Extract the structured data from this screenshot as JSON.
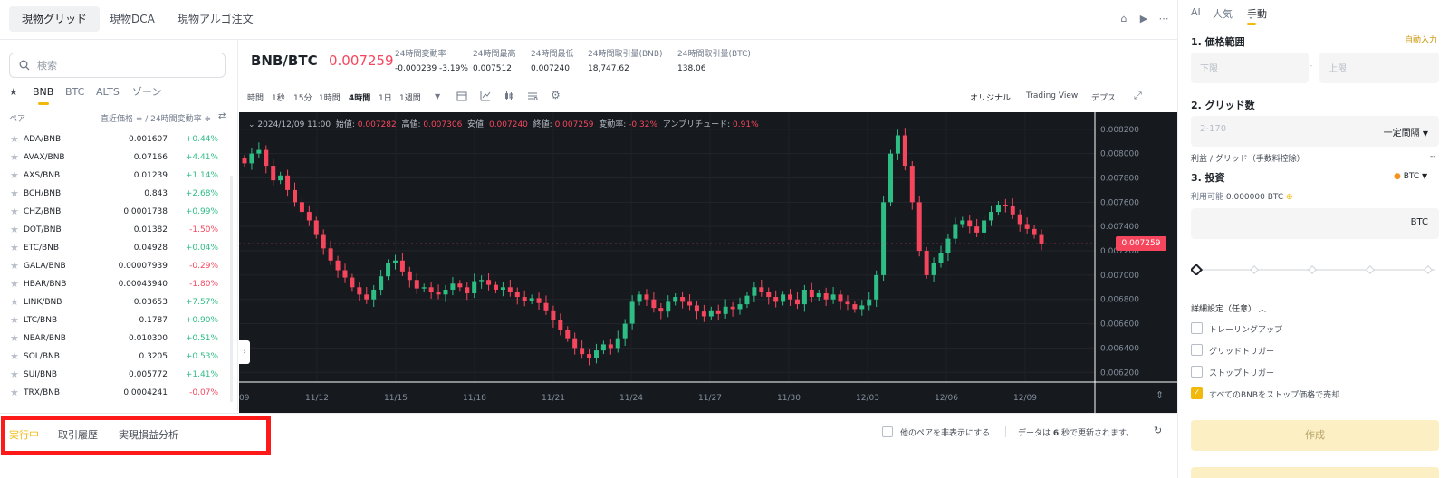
{
  "top_tabs": [
    "現物グリッド",
    "現物DCA",
    "現物アルゴ注文"
  ],
  "search": {
    "placeholder": "検索"
  },
  "quote_tabs": [
    "BNB",
    "BTC",
    "ALTS",
    "ゾーン"
  ],
  "list_header": {
    "pair": "ペア",
    "price_change": "直近価格 ≑ / 24時間変動率 ≑"
  },
  "markets": [
    {
      "pair": "ADA/BNB",
      "price": "0.001607",
      "change": "+0.44%",
      "dir": "up"
    },
    {
      "pair": "AVAX/BNB",
      "price": "0.07166",
      "change": "+4.41%",
      "dir": "up"
    },
    {
      "pair": "AXS/BNB",
      "price": "0.01239",
      "change": "+1.14%",
      "dir": "up"
    },
    {
      "pair": "BCH/BNB",
      "price": "0.843",
      "change": "+2.68%",
      "dir": "up"
    },
    {
      "pair": "CHZ/BNB",
      "price": "0.0001738",
      "change": "+0.99%",
      "dir": "up"
    },
    {
      "pair": "DOT/BNB",
      "price": "0.01382",
      "change": "-1.50%",
      "dir": "down"
    },
    {
      "pair": "ETC/BNB",
      "price": "0.04928",
      "change": "+0.04%",
      "dir": "up"
    },
    {
      "pair": "GALA/BNB",
      "price": "0.00007939",
      "change": "-0.29%",
      "dir": "down"
    },
    {
      "pair": "HBAR/BNB",
      "price": "0.00043940",
      "change": "-1.80%",
      "dir": "down"
    },
    {
      "pair": "LINK/BNB",
      "price": "0.03653",
      "change": "+7.57%",
      "dir": "up"
    },
    {
      "pair": "LTC/BNB",
      "price": "0.1787",
      "change": "+0.90%",
      "dir": "up"
    },
    {
      "pair": "NEAR/BNB",
      "price": "0.010300",
      "change": "+0.51%",
      "dir": "up"
    },
    {
      "pair": "SOL/BNB",
      "price": "0.3205",
      "change": "+0.53%",
      "dir": "up"
    },
    {
      "pair": "SUI/BNB",
      "price": "0.005772",
      "change": "+1.41%",
      "dir": "up"
    },
    {
      "pair": "TRX/BNB",
      "price": "0.0004241",
      "change": "-0.07%",
      "dir": "down"
    }
  ],
  "header": {
    "symbol": "BNB/BTC",
    "last_price": "0.007259",
    "stats": [
      {
        "label": "24時間変動率",
        "value": "-0.000239 -3.19%",
        "negative": true
      },
      {
        "label": "24時間最高",
        "value": "0.007512"
      },
      {
        "label": "24時間最低",
        "value": "0.007240"
      },
      {
        "label": "24時間取引量(BNB)",
        "value": "18,747.62"
      },
      {
        "label": "24時間取引量(BTC)",
        "value": "138.06"
      }
    ]
  },
  "timeframes": [
    "時間",
    "1秒",
    "15分",
    "1時間",
    "4時間",
    "1日",
    "1週間"
  ],
  "active_timeframe": "4時間",
  "chart_views": [
    "オリジナル",
    "Trading View",
    "デプス"
  ],
  "ohlc": {
    "date": "2024/12/09 11:00",
    "open_label": "始値:",
    "open": "0.007282",
    "high_label": "高値:",
    "high": "0.007306",
    "low_label": "安値:",
    "low": "0.007240",
    "close_label": "終値:",
    "close": "0.007259",
    "change_label": "変動率:",
    "change": "-0.32%",
    "amp_label": "アンプリチュード:",
    "amp": "0.91%"
  },
  "chart_data": {
    "type": "candlestick",
    "x_ticks": [
      "09",
      "11/12",
      "11/15",
      "11/18",
      "11/21",
      "11/24",
      "11/27",
      "11/30",
      "12/03",
      "12/06",
      "12/09"
    ],
    "y_ticks": [
      "0.008200",
      "0.008000",
      "0.007800",
      "0.007600",
      "0.007400",
      "0.007200",
      "0.007000",
      "0.006800",
      "0.006600",
      "0.006400",
      "0.006200"
    ],
    "ylim": [
      0.00612,
      0.00834
    ],
    "last_price": 0.007259,
    "close_path": [
      0.00792,
      0.008,
      0.00803,
      0.0079,
      0.00778,
      0.00782,
      0.0077,
      0.0076,
      0.00752,
      0.00745,
      0.00733,
      0.00722,
      0.00712,
      0.00704,
      0.00698,
      0.0069,
      0.00684,
      0.0068,
      0.00688,
      0.00699,
      0.0071,
      0.00712,
      0.00703,
      0.00696,
      0.00689,
      0.0069,
      0.00686,
      0.00684,
      0.00688,
      0.00693,
      0.0069,
      0.00685,
      0.00695,
      0.00696,
      0.00692,
      0.00688,
      0.0069,
      0.00686,
      0.00682,
      0.00679,
      0.00681,
      0.00677,
      0.00671,
      0.00663,
      0.00655,
      0.00648,
      0.0064,
      0.00635,
      0.00632,
      0.00638,
      0.00643,
      0.0064,
      0.00648,
      0.0066,
      0.00678,
      0.00684,
      0.0068,
      0.00673,
      0.0067,
      0.00678,
      0.00682,
      0.00678,
      0.00675,
      0.0067,
      0.00666,
      0.00671,
      0.00668,
      0.00674,
      0.00672,
      0.00676,
      0.00683,
      0.0069,
      0.00686,
      0.00682,
      0.00678,
      0.00684,
      0.0068,
      0.00676,
      0.00688,
      0.00682,
      0.00685,
      0.0068,
      0.00684,
      0.00678,
      0.00676,
      0.00672,
      0.00675,
      0.0068,
      0.007,
      0.0076,
      0.008,
      0.00815,
      0.0079,
      0.0076,
      0.0072,
      0.007,
      0.0071,
      0.00718,
      0.0073,
      0.00742,
      0.00745,
      0.0074,
      0.00735,
      0.00745,
      0.00752,
      0.00758,
      0.00757,
      0.0075,
      0.00742,
      0.00738,
      0.00733,
      0.00726
    ]
  },
  "bottom_tabs": [
    "実行中",
    "取引履歴",
    "実現損益分析"
  ],
  "bottom_right": {
    "hide_pairs": "他のペアを非表示にする",
    "refresh_prefix": "データは",
    "refresh_seconds": "6",
    "refresh_suffix": "秒で更新されます。"
  },
  "right_tabs": [
    "AI",
    "人気",
    "手動"
  ],
  "form": {
    "section1": "1. 価格範囲",
    "autofill": "自動入力",
    "lower_ph": "下限",
    "upper_ph": "上限",
    "section2": "2. グリッド数",
    "grid_ph": "2-170",
    "grid_mode": "一定間隔",
    "profit_label": "利益 / グリッド（手数料控除）",
    "profit_value": "--",
    "section3": "3. 投資",
    "invest_currency": "BTC",
    "available_label": "利用可能",
    "available_value": "0.000000 BTC",
    "amount_suffix": "BTC",
    "advanced": "詳細設定（任意）",
    "options": [
      {
        "label": "トレーリングアップ",
        "checked": false
      },
      {
        "label": "グリッドトリガー",
        "checked": false
      },
      {
        "label": "ストップトリガー",
        "checked": false
      },
      {
        "label": "すべてのBNBをストップ価格で売却",
        "checked": true
      }
    ],
    "create": "作成"
  },
  "colors": {
    "up": "#2ebd85",
    "down": "#f6465d",
    "accent": "#f0b90b",
    "chart_bg": "#161a1e"
  }
}
